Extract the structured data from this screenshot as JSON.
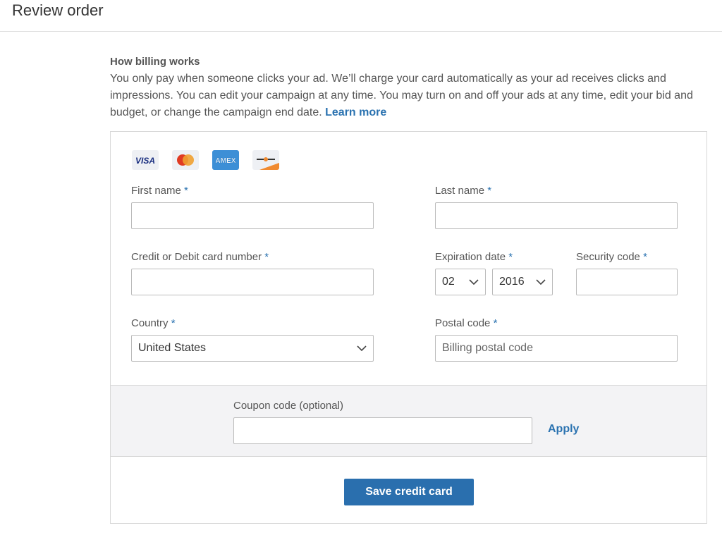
{
  "header": {
    "title": "Review order"
  },
  "billing": {
    "heading": "How billing works",
    "text": "You only pay when someone clicks your ad. We’ll charge your card automatically as your ad receives clicks and impressions. You can edit your campaign at any time.  You  may turn on and off your ads at any time, edit your bid and budget, or change the campaign end date. ",
    "learn_more": "Learn more"
  },
  "card_icons": [
    {
      "name": "visa-icon",
      "text": "VISA"
    },
    {
      "name": "mastercard-icon"
    },
    {
      "name": "amex-icon",
      "text": "AMEX"
    },
    {
      "name": "discover-icon"
    }
  ],
  "form": {
    "required_mark": "*",
    "first_name": {
      "label": "First name",
      "value": ""
    },
    "last_name": {
      "label": "Last name",
      "value": ""
    },
    "card_number": {
      "label": "Credit or Debit card number",
      "value": ""
    },
    "expiration": {
      "label": "Expiration date",
      "month": "02",
      "year": "2016"
    },
    "security": {
      "label": "Security code",
      "value": ""
    },
    "country": {
      "label": "Country",
      "value": "United States"
    },
    "postal": {
      "label": "Postal code",
      "placeholder": "Billing postal code"
    }
  },
  "coupon": {
    "label": "Coupon code (optional)",
    "value": "",
    "apply": "Apply"
  },
  "save_label": "Save credit card",
  "colors": {
    "accent": "#2a72b0",
    "button": "#2a6fae",
    "coupon_bg": "#f3f3f5"
  }
}
